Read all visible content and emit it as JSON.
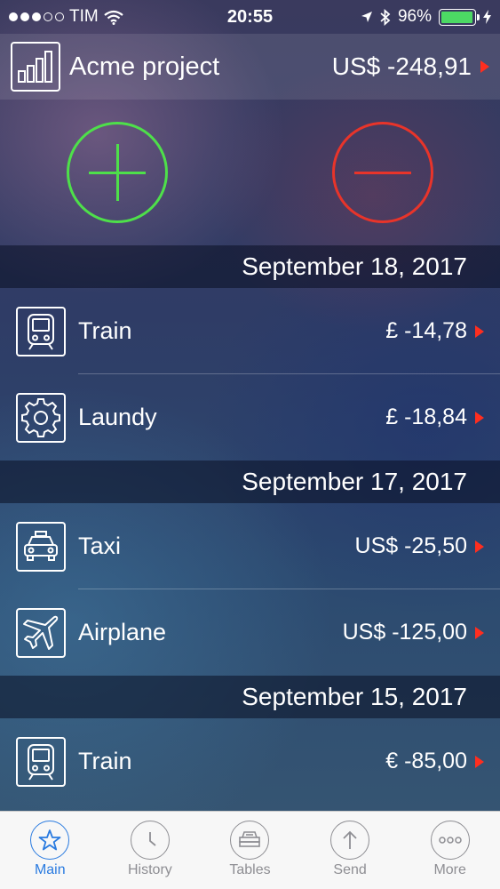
{
  "status_bar": {
    "carrier": "TIM",
    "time": "20:55",
    "battery": "96%",
    "signal_dots_filled": 3,
    "signal_dots_total": 5
  },
  "header": {
    "icon": "bar-chart-icon",
    "title": "Acme project",
    "total": "US$ -248,91"
  },
  "actions": {
    "add_icon": "plus-icon",
    "subtract_icon": "minus-icon"
  },
  "sections": [
    {
      "date": "September 18, 2017",
      "items": [
        {
          "icon": "train-icon",
          "label": "Train",
          "amount": "£ -14,78"
        },
        {
          "icon": "gear-icon",
          "label": "Laundy",
          "amount": "£ -18,84"
        }
      ]
    },
    {
      "date": "September 17, 2017",
      "items": [
        {
          "icon": "taxi-icon",
          "label": "Taxi",
          "amount": "US$ -25,50"
        },
        {
          "icon": "airplane-icon",
          "label": "Airplane",
          "amount": "US$ -125,00"
        }
      ]
    },
    {
      "date": "September 15, 2017",
      "items": [
        {
          "icon": "train-icon",
          "label": "Train",
          "amount": "€ -85,00"
        }
      ]
    }
  ],
  "tabs": [
    {
      "icon": "star-icon",
      "label": "Main",
      "active": true
    },
    {
      "icon": "clock-icon",
      "label": "History",
      "active": false
    },
    {
      "icon": "tables-icon",
      "label": "Tables",
      "active": false
    },
    {
      "icon": "send-icon",
      "label": "Send",
      "active": false
    },
    {
      "icon": "more-icon",
      "label": "More",
      "active": false
    }
  ],
  "colors": {
    "accent": "#2a7be0",
    "positive": "#4ee04a",
    "negative": "#e8342a",
    "battery": "#4cd964",
    "chevron": "#ff2e1f"
  }
}
